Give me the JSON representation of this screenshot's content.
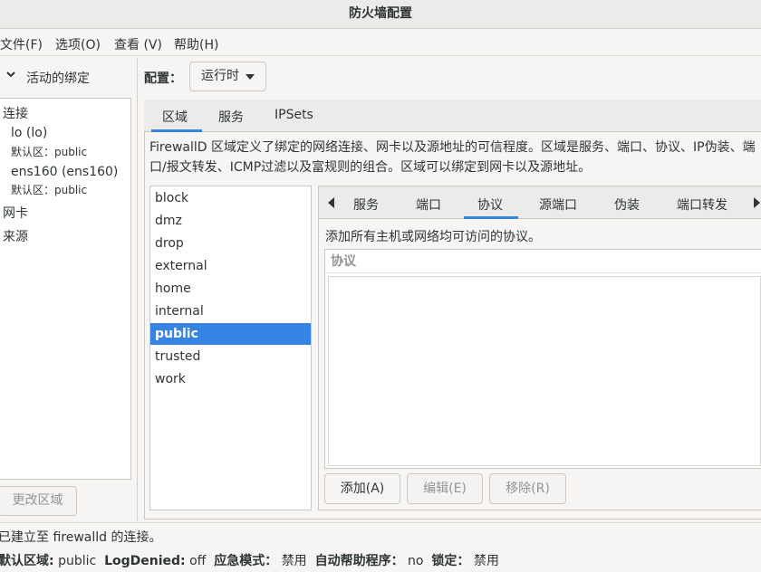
{
  "window": {
    "title": "防火墙配置"
  },
  "menu": [
    "文件(F)",
    "选项(O)",
    "查看 (V)",
    "帮助(H)"
  ],
  "sidebar": {
    "header": "活动的绑定",
    "connections_heading": "连接",
    "connections": [
      {
        "name": "lo (lo)",
        "zone": "默认区：public"
      },
      {
        "name": "ens160 (ens160)",
        "zone": "默认区：public"
      }
    ],
    "nics_heading": "网卡",
    "sources_heading": "来源",
    "change_zone_button": "更改区域"
  },
  "config": {
    "label": "配置：",
    "value": "运行时"
  },
  "tabs": [
    "区域",
    "服务",
    "IPSets"
  ],
  "zone_description": "FirewallD 区域定义了绑定的网络连接、网卡以及源地址的可信程度。区域是服务、端口、协议、IP伪装、端口/报文转发、ICMP过滤以及富规则的组合。区域可以绑定到网卡以及源地址。",
  "zones": [
    "block",
    "dmz",
    "drop",
    "external",
    "home",
    "internal",
    "public",
    "trusted",
    "work"
  ],
  "selected_zone": "public",
  "inner_tabs": [
    "服务",
    "端口",
    "协议",
    "源端口",
    "伪装",
    "端口转发"
  ],
  "active_inner_tab": "协议",
  "protocols": {
    "description": "添加所有主机或网络均可访问的协议。",
    "column_header": "协议",
    "add_button": "添加(A)",
    "edit_button": "编辑(E)",
    "remove_button": "移除(R)"
  },
  "status": {
    "connection": "已建立至 firewalld 的连接。",
    "default_zone_label": "默认区域:",
    "default_zone": "public",
    "log_denied_label": "LogDenied:",
    "log_denied": "off",
    "panic_label": "应急模式：",
    "panic": "禁用",
    "helper_label": "自动帮助程序：",
    "helper": "no",
    "lockdown_label": "锁定：",
    "lockdown": "禁用"
  },
  "colors": {
    "accent": "#3584e4",
    "window_bg": "#f6f5f4"
  }
}
